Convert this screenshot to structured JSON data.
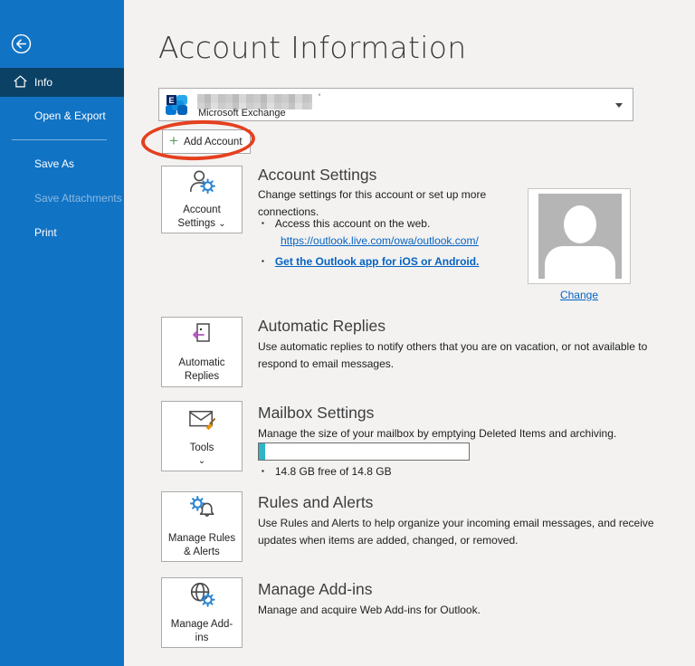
{
  "colors": {
    "sidebar_blue": "#1173c4",
    "sidebar_selected": "#0c4166",
    "link_blue": "#0563c1",
    "annotation_red": "#e5401f",
    "progress_teal": "#2fb6c4",
    "background": "#f3f2f1"
  },
  "icons": {
    "chevron_down": "⌄",
    "bullet": "▪",
    "plus": "+"
  },
  "sidebar": {
    "items": [
      {
        "label": "Info",
        "selected": true
      },
      {
        "label": "Open & Export",
        "selected": false
      },
      {
        "label": "Save As",
        "selected": false
      },
      {
        "label": "Save Attachments",
        "selected": false,
        "disabled": true
      },
      {
        "label": "Print",
        "selected": false
      }
    ]
  },
  "header": {
    "title": "Account Information"
  },
  "account_selector": {
    "provider": "Microsoft Exchange",
    "redacted_suffix": "'",
    "email_redacted": true
  },
  "add_account": {
    "label": "Add Account"
  },
  "account_settings": {
    "button_label": "Account Settings",
    "heading": "Account Settings",
    "body": "Change settings for this account or set up more connections.",
    "bullet1": "Access this account on the web.",
    "link1": "https://outlook.live.com/owa/outlook.com/",
    "link2": "Get the Outlook app for iOS or Android.",
    "change_link": "Change"
  },
  "automatic_replies": {
    "button_label": "Automatic Replies",
    "heading": "Automatic Replies",
    "body": "Use automatic replies to notify others that you are on vacation, or not available to respond to email messages."
  },
  "mailbox_settings": {
    "button_label": "Tools",
    "heading": "Mailbox Settings",
    "body": "Manage the size of your mailbox by emptying Deleted Items and archiving.",
    "storage": "14.8 GB free of 14.8 GB",
    "progress_percent": 3,
    "progress_style": "width:7px"
  },
  "rules_alerts": {
    "button_label": "Manage Rules & Alerts",
    "heading": "Rules and Alerts",
    "body": "Use Rules and Alerts to help organize your incoming email messages, and receive updates when items are added, changed, or removed."
  },
  "manage_addins": {
    "button_label": "Manage Add-ins",
    "heading": "Manage Add-ins",
    "body": "Manage and acquire Web Add-ins for Outlook."
  }
}
